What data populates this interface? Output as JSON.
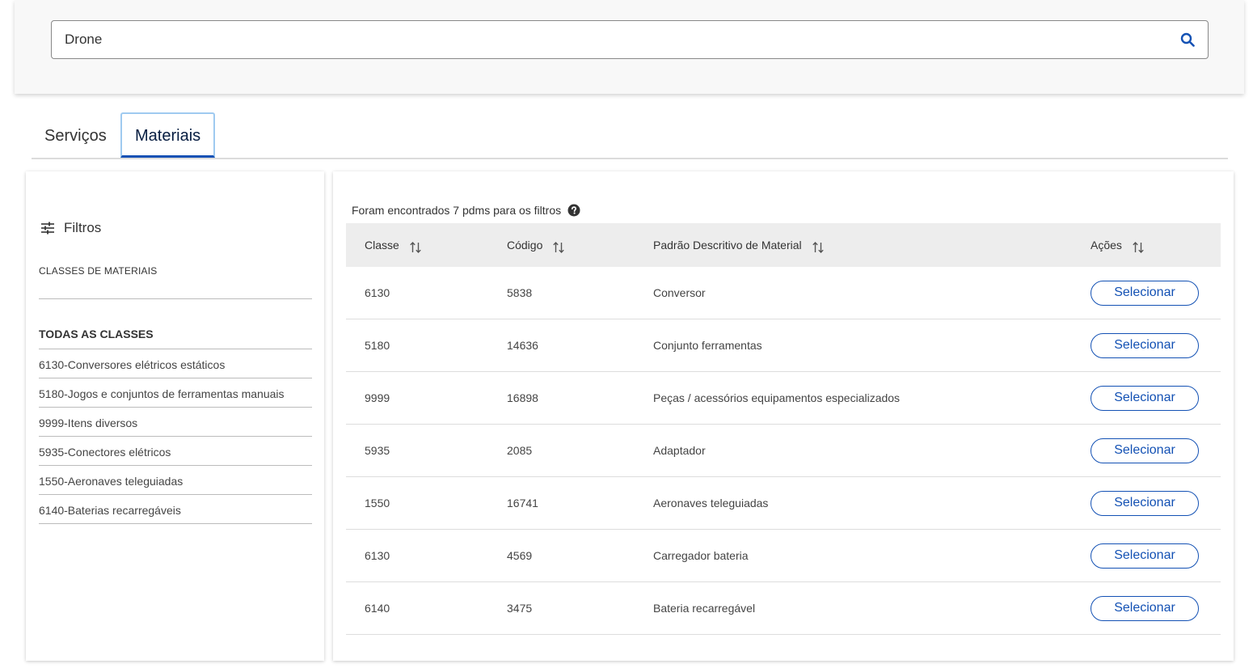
{
  "search": {
    "value": "Drone"
  },
  "tabs": [
    {
      "label": "Serviços",
      "active": false
    },
    {
      "label": "Materiais",
      "active": true
    }
  ],
  "filters": {
    "title": "Filtros",
    "section_label": "CLASSES DE MATERIAIS",
    "all_classes_label": "TODAS AS CLASSES",
    "classes": [
      "6130-Conversores elétricos estáticos",
      "5180-Jogos e conjuntos de ferramentas manuais",
      "9999-Itens diversos",
      "5935-Conectores elétricos",
      "1550-Aeronaves teleguiadas",
      "6140-Baterias recarregáveis"
    ]
  },
  "results": {
    "summary": "Foram encontrados 7 pdms para os filtros",
    "columns": [
      "Classe",
      "Código",
      "Padrão Descritivo de Material",
      "Ações"
    ],
    "rows": [
      {
        "classe": "6130",
        "codigo": "5838",
        "padrao": "Conversor",
        "action": "Selecionar"
      },
      {
        "classe": "5180",
        "codigo": "14636",
        "padrao": "Conjunto ferramentas",
        "action": "Selecionar"
      },
      {
        "classe": "9999",
        "codigo": "16898",
        "padrao": "Peças / acessórios equipamentos especializados",
        "action": "Selecionar"
      },
      {
        "classe": "5935",
        "codigo": "2085",
        "padrao": "Adaptador",
        "action": "Selecionar"
      },
      {
        "classe": "1550",
        "codigo": "16741",
        "padrao": "Aeronaves teleguiadas",
        "action": "Selecionar"
      },
      {
        "classe": "6130",
        "codigo": "4569",
        "padrao": "Carregador bateria",
        "action": "Selecionar"
      },
      {
        "classe": "6140",
        "codigo": "3475",
        "padrao": "Bateria recarregável",
        "action": "Selecionar"
      }
    ]
  },
  "colors": {
    "primary": "#1351b4",
    "tab_focus": "#9fcaf0",
    "header_bg": "#ededed"
  },
  "icons": {
    "search": "search-icon",
    "filter": "sliders-icon",
    "help": "question-circle-icon",
    "sort": "sort-arrows-icon"
  }
}
